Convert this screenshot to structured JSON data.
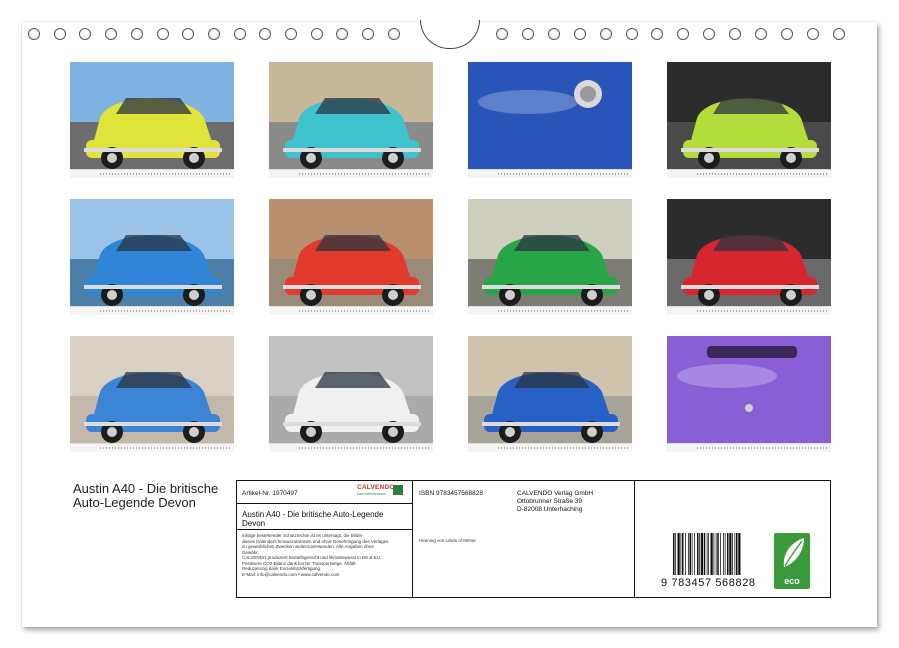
{
  "calendar": {
    "title": "Austin A40 - Die britische Auto-Legende Devon",
    "photos": [
      {
        "name": "photo-yellow-front",
        "color": "#dfe33a",
        "caption": "HDH861"
      },
      {
        "name": "photo-turquoise",
        "color": "#3fc4cf",
        "caption": ""
      },
      {
        "name": "photo-blue-detail",
        "color": "#2a55b8",
        "caption": ""
      },
      {
        "name": "photo-lime-rear",
        "color": "#b4dc3a",
        "caption": ""
      },
      {
        "name": "photo-blue-seaside",
        "color": "#2f86d8",
        "caption": ""
      },
      {
        "name": "photo-red-rear",
        "color": "#e13b2e",
        "caption": ""
      },
      {
        "name": "photo-green",
        "color": "#28a548",
        "caption": ""
      },
      {
        "name": "photo-red-front",
        "color": "#d8262f",
        "caption": ""
      },
      {
        "name": "photo-blue-rear",
        "color": "#3c84d6",
        "caption": ""
      },
      {
        "name": "photo-white",
        "color": "#f1f1f1",
        "caption": ""
      },
      {
        "name": "photo-blue-front",
        "color": "#2761c6",
        "caption": ""
      },
      {
        "name": "photo-purple-trunk",
        "color": "#8a5fd6",
        "caption": "Austin 51"
      }
    ]
  },
  "info_box": {
    "article_label": "Artikel-Nr. 1970497",
    "logo_text": "CALVENDO",
    "logo_sub": "Das Kalenderhaus",
    "title": "Austin A40 - Die britische Auto-Legende Devon",
    "isbn": "ISBN 9783457568828",
    "publisher_name": "CALVENDO Verlag GmbH",
    "publisher_street": "Ottobrunner Straße 39",
    "publisher_city": "D-82008 Unterhaching",
    "author": "Henning von Löwis of Menar",
    "legal_1": "Infolge bestehender Schutzrechte ist es untersagt, die Bilder",
    "legal_2": "dieses Kalenders herauszutrennen und ohne Genehmigung des Verlages",
    "legal_3": "zu gewerblichen Zwecken weiterzuverwenden. Alle Angaben ohne",
    "legal_4": "Gewähr.",
    "legal_5": "CALVENDO produziert bedarfsgerecht und klimabewusst in DE & EU.",
    "legal_6": "Positivere CO2-Bilanz dank kurzer Transportwege. Abfall-",
    "legal_7": "Reduzierung dank Einzelstückfertigung.",
    "legal_8": "E-Mail: info@calvendo.com • www.calvendo.com",
    "barcode_number": "9 783457 568828",
    "eco_label": "eco"
  }
}
